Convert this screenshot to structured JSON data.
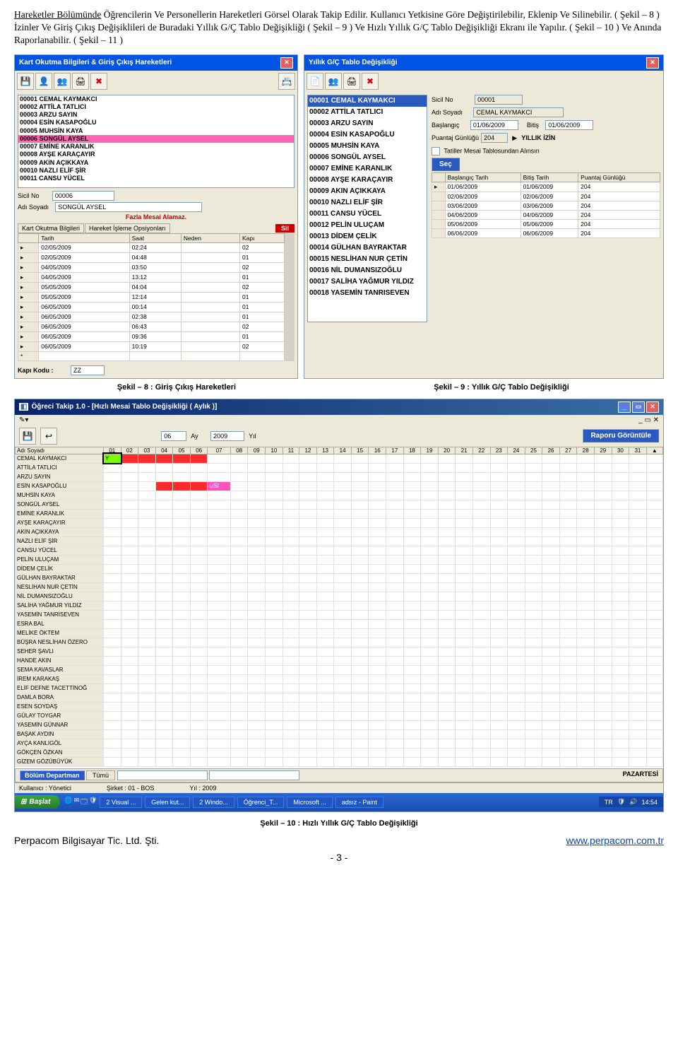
{
  "intro_paragraph": "Hareketler Bölümünde Öğrencilerin Ve Personellerin Hareketleri Görsel Olarak Takip Edilir. Kullanıcı Yetkisine Göre Değiştirilebilir, Eklenip Ve Silinebilir. ( Şekil – 8 ) İzinler Ve Giriş Çıkış Değişiklileri de Buradaki Yıllık G/Ç Tablo Değişikliği ( Şekil – 9 ) Ve Hızlı Yıllık G/Ç Tablo Değişikliği Ekranı ile Yapılır. ( Şekil – 10 ) Ve Anında Raporlanabilir. ( Şekil – 11 )",
  "intro_underlined": "Hareketler Bölümünde",
  "left_panel": {
    "title": "Kart Okutma Bilgileri & Giriş Çıkış Hareketleri",
    "list": [
      "00001   CEMAL KAYMAKCI",
      "00002   ATTİLA TATLICI",
      "00003   ARZU SAYIN",
      "00004   ESİN KASAPOĞLU",
      "00005   MUHSİN KAYA",
      "00006   SONGÜL AYSEL",
      "00007   EMİNE KARANLIK",
      "00008   AYŞE KARAÇAYIR",
      "00009   AKIN AÇIKKAYA",
      "00010   NAZLI ELİF ŞİR",
      "00011   CANSU YÜCEL"
    ],
    "sel_index": 5,
    "sicil_lbl": "Sicil No",
    "sicil_val": "00006",
    "ad_lbl": "Adı Soyadı",
    "ad_val": "SONGÜL AYSEL",
    "warn": "Fazla Mesai Alamaz.",
    "tabs": [
      "Kart Okutma Bilgileri",
      "Hareket İşleme Opsiyonları"
    ],
    "sil": "Sil",
    "cols": [
      "Tarih",
      "Saat",
      "Neden",
      "Kapı"
    ],
    "rows": [
      [
        "02/05/2009",
        "02:24",
        "",
        "02"
      ],
      [
        "02/05/2009",
        "04:48",
        "",
        "01"
      ],
      [
        "04/05/2009",
        "03:50",
        "",
        "02"
      ],
      [
        "04/05/2009",
        "13:12",
        "",
        "01"
      ],
      [
        "05/05/2009",
        "04:04",
        "",
        "02"
      ],
      [
        "05/05/2009",
        "12:14",
        "",
        "01"
      ],
      [
        "06/05/2009",
        "00:14",
        "",
        "01"
      ],
      [
        "06/05/2009",
        "02:38",
        "",
        "01"
      ],
      [
        "06/05/2009",
        "06:43",
        "",
        "02"
      ],
      [
        "06/05/2009",
        "09:36",
        "",
        "01"
      ],
      [
        "06/05/2009",
        "10:19",
        "",
        "02"
      ]
    ],
    "kapi_lbl": "Kapı Kodu   :",
    "kapi_val": "ZZ"
  },
  "right_panel": {
    "title": "Yıllık G/Ç Tablo Değişikliği",
    "list": [
      "00001  CEMAL KAYMAKCI",
      "00002  ATTİLA TATLICI",
      "00003  ARZU SAYIN",
      "00004  ESİN KASAPOĞLU",
      "00005  MUHSİN KAYA",
      "00006  SONGÜL AYSEL",
      "00007  EMİNE KARANLIK",
      "00008  AYŞE KARAÇAYIR",
      "00009  AKIN AÇIKKAYA",
      "00010  NAZLI ELİF ŞİR",
      "00011  CANSU YÜCEL",
      "00012  PELİN ULUÇAM",
      "00013  DİDEM ÇELİK",
      "00014  GÜLHAN BAYRAKTAR",
      "00015  NESLİHAN NUR ÇETİN",
      "00016  NİL DUMANSIZOĞLU",
      "00017  SALİHA YAĞMUR YILDIZ",
      "00018  YASEMİN TANRISEVEN"
    ],
    "sicil_lbl": "Sicil No",
    "sicil_val": "00001",
    "ad_lbl": "Adı Soyadı",
    "ad_val": "CEMAL KAYMAKCI",
    "bas_lbl": "Başlangıç",
    "bas_val": "01/06/2009",
    "bit_lbl": "Bitiş",
    "bit_val": "01/06/2009",
    "pg_lbl": "Puantaj Günlüğü",
    "pg_val": "204",
    "izin": "YILLIK İZİN",
    "chk": "Tatiller Mesai Tablosundan Alınsın",
    "sec": "Seç",
    "cols": [
      "Başlangıç Tarih",
      "Bitiş Tarih",
      "Puantaj Günlüğü"
    ],
    "rows": [
      [
        "01/06/2009",
        "01/06/2009",
        "204"
      ],
      [
        "02/06/2009",
        "02/06/2009",
        "204"
      ],
      [
        "03/06/2009",
        "03/06/2009",
        "204"
      ],
      [
        "04/06/2009",
        "04/06/2009",
        "204"
      ],
      [
        "05/06/2009",
        "05/06/2009",
        "204"
      ],
      [
        "06/06/2009",
        "06/06/2009",
        "204"
      ]
    ]
  },
  "cap8": "Şekil – 8 : Giriş Çıkış Hareketleri",
  "cap9": "Şekil – 9 : Yıllık G/Ç Tablo Değişikliği",
  "wide": {
    "title": "Öğreci Takip 1.0 - [Hızlı Mesai Tablo Değişikliği ( Aylık )]",
    "month_val": "06",
    "month_lbl": "Ay",
    "year_val": "2009",
    "year_lbl": "Yıl",
    "rapor": "Raporu Görüntüle",
    "name_h": "Adı Soyadı",
    "days": [
      "01",
      "02",
      "03",
      "04",
      "05",
      "06",
      "07",
      "08",
      "09",
      "10",
      "11",
      "12",
      "13",
      "14",
      "15",
      "16",
      "17",
      "18",
      "19",
      "20",
      "21",
      "22",
      "23",
      "24",
      "25",
      "26",
      "27",
      "28",
      "29",
      "30",
      "31"
    ],
    "names": [
      "CEMAL KAYMAKCI",
      "ATTİLA TATLICI",
      "ARZU SAYIN",
      "ESİN KASAPOĞLU",
      "MUHSİN KAYA",
      "SONGÜL AYSEL",
      "EMİNE KARANLIK",
      "AYŞE KARAÇAYIR",
      "AKIN AÇIKKAYA",
      "NAZLI ELİF ŞİR",
      "CANSU YÜCEL",
      "PELİN ULUÇAM",
      "DİDEM ÇELİK",
      "GÜLHAN BAYRAKTAR",
      "NESLİHAN NUR ÇETİN",
      "NİL DUMANSIZOĞLU",
      "SALİHA YAĞMUR YILDIZ",
      "YASEMİN TANRISEVEN",
      "ESRA BAL",
      "MELİKE ÖKTEM",
      "BÜŞRA NESLİHAN ÖZERO",
      "SEHER ŞAVLI",
      "HANDE AKIN",
      "SEMA KAVASLAR",
      "İREM KARAKAŞ",
      "ELİF DEFNE TACETTİNOĞ",
      "DAMLA BORA",
      "ESEN SOYDAŞ",
      "GÜLAY TOYGAR",
      "YASEMİN GÜNNAR",
      "BAŞAK AYDIN",
      "AYÇA KANLIGÖL",
      "GÖKÇEN ÖZKAN",
      "GİZEM GÖZÜBÜYÜK"
    ],
    "dep_btn": "Bölüm Departman",
    "tumu_btn": "Tümü",
    "day_lbl": "PAZARTESİ",
    "kul": "Kullanıcı : Yönetici",
    "sirket": "Şirket : 01 - BOS",
    "yil": "Yıl : 2009"
  },
  "taskbar": {
    "start": "Başlat",
    "tasks": [
      "2 Visual ...",
      "Gelen kut...",
      "2 Windo...",
      "Öğrenci_T...",
      "Microsoft ...",
      "adsız - Paint"
    ],
    "lang": "TR",
    "time": "14:54"
  },
  "cap10": "Şekil – 10 : Hızlı Yıllık G/Ç Tablo Değişikliği",
  "footer": {
    "left": "Perpacom Bilgisayar Tic. Ltd. Şti.",
    "right": "www.perpacom.com.tr",
    "page": "- 3 -"
  }
}
